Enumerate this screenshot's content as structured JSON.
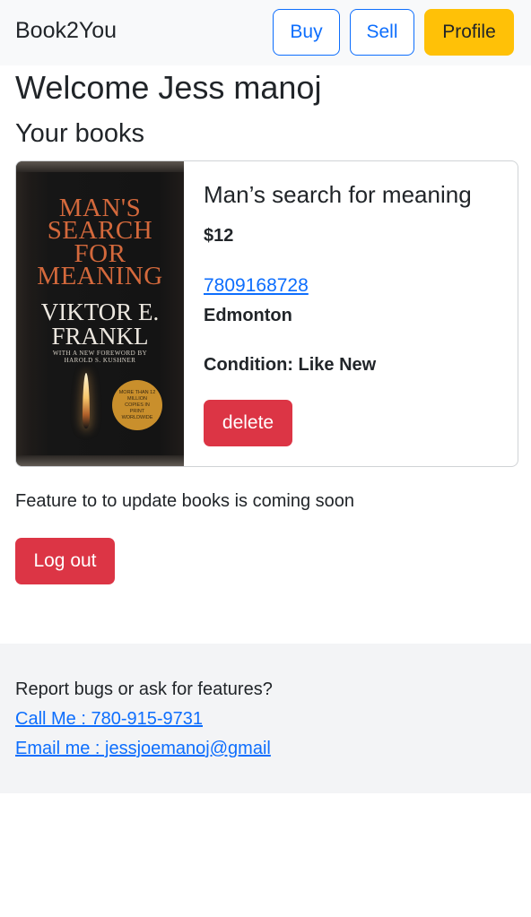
{
  "navbar": {
    "brand": "Book2You",
    "buy_label": "Buy",
    "sell_label": "Sell",
    "profile_label": "Profile"
  },
  "welcome": "Welcome Jess manoj",
  "section_title": "Your books",
  "book": {
    "title": "Man’s search for meaning",
    "price": "$12",
    "phone": "7809168728",
    "city": "Edmonton",
    "condition": "Condition: Like New",
    "delete_label": "delete",
    "cover": {
      "title_lines": [
        "MAN'S",
        "SEARCH",
        "FOR",
        "MEANING"
      ],
      "author_lines": [
        "VIKTOR E.",
        "FRANKL"
      ],
      "foreword_lines": [
        "WITH A NEW FOREWORD BY",
        "HAROLD S. KUSHNER"
      ],
      "seal": "MORE THAN 12 MILLION COPIES IN PRINT WORLDWIDE"
    }
  },
  "notice": "Feature to to update books is coming soon",
  "logout_label": "Log out",
  "footer": {
    "question": "Report bugs or ask for features?",
    "call": "Call Me : 780-915-9731",
    "email": "Email me : jessjoemanoj@gmail"
  },
  "colors": {
    "primary": "#0d6efd",
    "warning": "#ffc107",
    "danger": "#dc3545",
    "navbar_bg": "#f8f9fa",
    "footer_bg": "#f3f4f6"
  }
}
